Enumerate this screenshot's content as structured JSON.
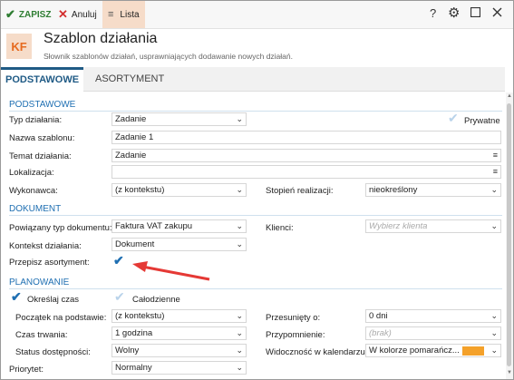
{
  "toolbar": {
    "save_label": "ZAPISZ",
    "cancel_label": "Anuluj",
    "list_label": "Lista",
    "help_label": "?"
  },
  "header": {
    "badge": "KF",
    "title": "Szablon działania",
    "subtitle": "Słownik szablonów działań, usprawniających dodawanie nowych działań."
  },
  "tabs": [
    {
      "label": "PODSTAWOWE"
    },
    {
      "label": "ASORTYMENT"
    }
  ],
  "sections": {
    "basic": "PODSTAWOWE",
    "document": "DOKUMENT",
    "planning": "PLANOWANIE"
  },
  "basic": {
    "type_label": "Typ działania:",
    "type_value": "Zadanie",
    "private_label": "Prywatne",
    "name_label": "Nazwa szablonu:",
    "name_value": "Zadanie 1",
    "topic_label": "Temat działania:",
    "topic_value": "Zadanie",
    "location_label": "Lokalizacja:",
    "location_value": "",
    "executor_label": "Wykonawca:",
    "executor_value": "(z kontekstu)",
    "progress_label": "Stopień realizacji:",
    "progress_value": "nieokreślony"
  },
  "document": {
    "doc_type_label": "Powiązany typ dokumentu:",
    "doc_type_value": "Faktura VAT zakupu",
    "clients_label": "Klienci:",
    "clients_placeholder": "Wybierz klienta",
    "context_label": "Kontekst działania:",
    "context_value": "Dokument",
    "copy_items_label": "Przepisz asortyment:",
    "copy_items_checked": true
  },
  "planning": {
    "define_time_label": "Określaj czas",
    "define_time_checked": true,
    "all_day_label": "Całodzienne",
    "all_day_checked": false,
    "start_label": "Początek na podstawie:",
    "start_value": "(z kontekstu)",
    "shifted_label": "Przesunięty o:",
    "shifted_value": "0 dni",
    "duration_label": "Czas trwania:",
    "duration_value": "1 godzina",
    "reminder_label": "Przypomnienie:",
    "reminder_placeholder": "(brak)",
    "availability_label": "Status dostępności:",
    "availability_value": "Wolny",
    "calendar_label": "Widoczność w kalendarzu:",
    "calendar_value": "W kolorze pomarańcz...",
    "calendar_color": "#F4A12A",
    "priority_label": "Priorytet:",
    "priority_value": "Normalny"
  },
  "colors": {
    "accent": "#1F6FB2",
    "save_green": "#2E7D32",
    "cancel_red": "#D32F2F",
    "annotation_arrow": "#E53935"
  }
}
